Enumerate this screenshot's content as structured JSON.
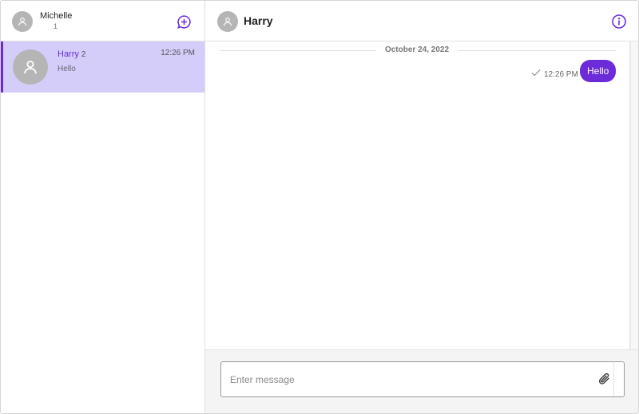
{
  "colors": {
    "accent": "#6c2bd9",
    "selected_bg": "#d4cdfa",
    "avatar_gray": "#b5b5b5"
  },
  "sidebar": {
    "user": {
      "name": "Michelle",
      "sub": "1",
      "avatar_icon": "user-icon"
    },
    "new_chat_icon": "new-chat-icon",
    "conversations": [
      {
        "name": "Harry",
        "badge": "2",
        "preview": "Hello",
        "time": "12:26 PM",
        "selected": true,
        "avatar_icon": "user-icon"
      }
    ]
  },
  "chat": {
    "contact_name": "Harry",
    "contact_avatar_icon": "user-icon",
    "info_icon": "info-icon",
    "date_separator": "October 24, 2022",
    "messages": [
      {
        "text": "Hello",
        "time": "12:26 PM",
        "status_icon": "check-icon",
        "outgoing": true
      }
    ],
    "composer": {
      "placeholder": "Enter message",
      "value": "",
      "attach_icon": "paperclip-icon"
    }
  }
}
